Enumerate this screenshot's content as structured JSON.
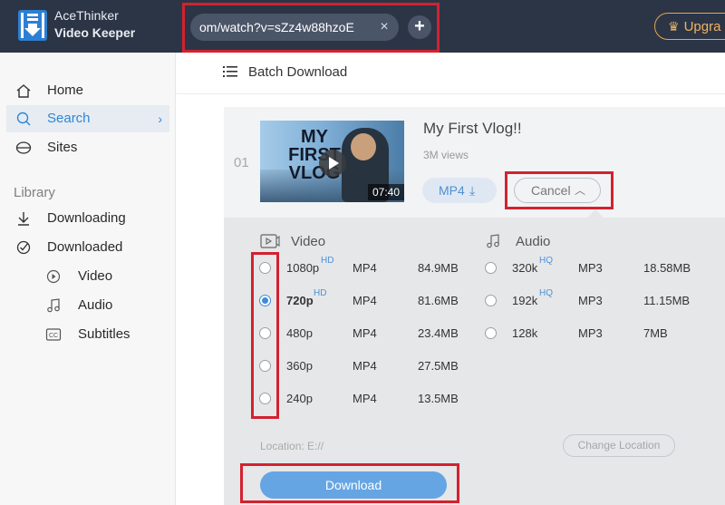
{
  "app": {
    "name_line1": "AceThinker",
    "name_line2": "Video Keeper",
    "url_value": "om/watch?v=sZz4w88hzoE",
    "clear_icon": "×",
    "add_icon": "+",
    "upgrade_label": "Upgra"
  },
  "sidebar": {
    "home": "Home",
    "search": "Search",
    "sites": "Sites",
    "library_label": "Library",
    "downloading": "Downloading",
    "downloaded": "Downloaded",
    "video": "Video",
    "audio": "Audio",
    "subtitles": "Subtitles"
  },
  "toolbar": {
    "batch_download": "Batch Download"
  },
  "item": {
    "index": "01",
    "thumbnail_title": "MY FIRST VLOG",
    "duration": "07:40",
    "title": "My First Vlog!!",
    "views": "3M views",
    "format_button": "MP4",
    "cancel_button": "Cancel"
  },
  "options": {
    "video_heading": "Video",
    "audio_heading": "Audio",
    "video": [
      {
        "quality": "1080p",
        "badge": "HD",
        "format": "MP4",
        "size": "84.9MB",
        "selected": false
      },
      {
        "quality": "720p",
        "badge": "HD",
        "format": "MP4",
        "size": "81.6MB",
        "selected": true
      },
      {
        "quality": "480p",
        "badge": "",
        "format": "MP4",
        "size": "23.4MB",
        "selected": false
      },
      {
        "quality": "360p",
        "badge": "",
        "format": "MP4",
        "size": "27.5MB",
        "selected": false
      },
      {
        "quality": "240p",
        "badge": "",
        "format": "MP4",
        "size": "13.5MB",
        "selected": false
      }
    ],
    "audio": [
      {
        "quality": "320k",
        "badge": "HQ",
        "format": "MP3",
        "size": "18.58MB",
        "selected": false
      },
      {
        "quality": "192k",
        "badge": "HQ",
        "format": "MP3",
        "size": "11.15MB",
        "selected": false
      },
      {
        "quality": "128k",
        "badge": "",
        "format": "MP3",
        "size": "7MB",
        "selected": false
      }
    ],
    "location": "Location: E://",
    "change_location": "Change Location",
    "download_button": "Download"
  },
  "colors": {
    "accent": "#2e86d8",
    "annotation": "#d2222f",
    "topbar": "#2c3546"
  }
}
